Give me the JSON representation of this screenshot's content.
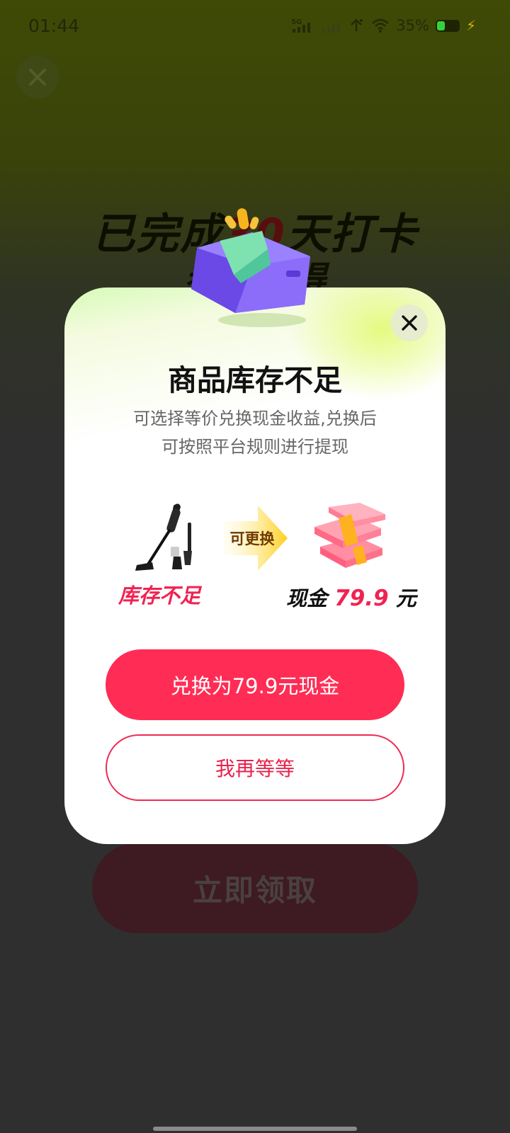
{
  "status_bar": {
    "time": "01:44",
    "network": "5G",
    "battery_percent": "35%",
    "battery_level": 0.35,
    "icons": [
      "5g-signal-icon",
      "signal-icon",
      "hotspot-icon",
      "wifi-icon",
      "battery-icon",
      "charging-bolt-icon"
    ]
  },
  "background": {
    "heading_prefix": "已完成",
    "heading_num": "30",
    "heading_suffix": "天打卡",
    "heading2": "恭喜获得",
    "claim_button": "立即领取"
  },
  "modal": {
    "title": "商品库存不足",
    "desc_line1": "可选择等价兑换现金收益,兑换后",
    "desc_line2": "可按照平台规则进行提现",
    "exchange_label": "可更换",
    "out_of_stock": "库存不足",
    "cash_label": "现金",
    "cash_amount": "79.9",
    "cash_unit": "元",
    "primary_button": "兑换为79.9元现金",
    "secondary_button": "我再等等"
  },
  "colors": {
    "accent": "#ff2d55",
    "dim_bg": "#2e2e2e",
    "gradient_top": "#d6fbb8"
  }
}
